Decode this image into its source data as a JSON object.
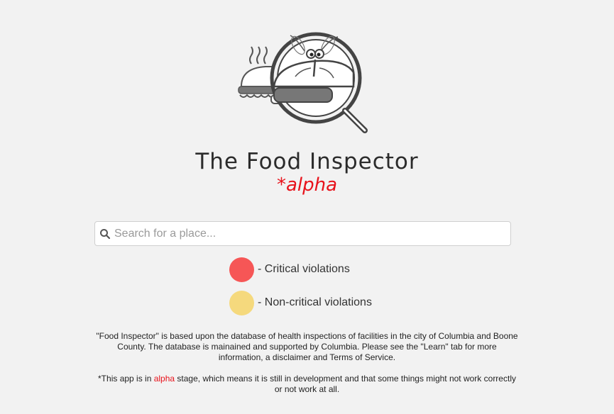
{
  "app": {
    "title": "The Food Inspector",
    "alpha_tag": "*alpha"
  },
  "search": {
    "placeholder": "Search for a place..."
  },
  "legend": [
    {
      "label": "- Critical violations",
      "color": "#f65656"
    },
    {
      "label": "- Non-critical violations",
      "color": "#f5d97d"
    }
  ],
  "info": {
    "paragraph1": "\"Food Inspector\" is based upon the database of health inspections of facilities in the city of Columbia and Boone County. The database is mainained and supported by Columbia. Please see the \"Learn\" tab for more information, a disclaimer and Terms of Service.",
    "paragraph2_before": "*This app is in ",
    "paragraph2_alpha": "alpha",
    "paragraph2_after": " stage, which means it is still in development and that some things might not work correctly or not work at all."
  },
  "colors": {
    "accent": "#e8121b",
    "background": "#f2f2f2"
  },
  "icons": {
    "logo": "magnifier-over-sandwich-with-bug",
    "search": "search-icon"
  }
}
